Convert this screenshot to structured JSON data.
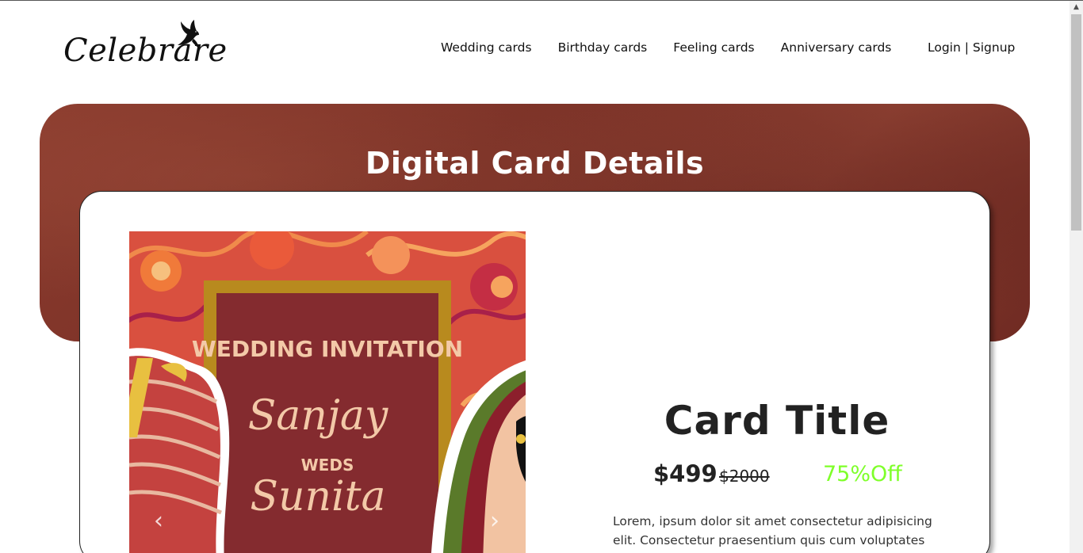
{
  "brand": {
    "name": "Celebrare",
    "icon": "dove-icon"
  },
  "nav": {
    "items": [
      {
        "label": "Wedding cards"
      },
      {
        "label": "Birthday cards"
      },
      {
        "label": "Feeling cards"
      },
      {
        "label": "Anniversary cards"
      }
    ],
    "login_label": "Login",
    "separator": " | ",
    "signup_label": "Signup"
  },
  "banner": {
    "title": "Digital Card Details"
  },
  "card_image": {
    "heading": "WEDDING INVITATION",
    "name_one": "Sanjay",
    "weds": "WEDS",
    "name_two": "Sunita",
    "prev_icon": "chevron-left-icon",
    "next_icon": "chevron-right-icon"
  },
  "product": {
    "title": "Card Title",
    "price": "$499",
    "original_price": "$2000",
    "discount": "75%Off",
    "description": "Lorem, ipsum dolor sit amet consectetur adipisicing elit. Consectetur praesentium quis cum voluptates amet"
  },
  "colors": {
    "banner": "#7a3026",
    "discount": "#7fff2a",
    "card_frame": "#b88a1e",
    "card_panel": "#842b2f",
    "card_text": "#f3c9a8"
  }
}
